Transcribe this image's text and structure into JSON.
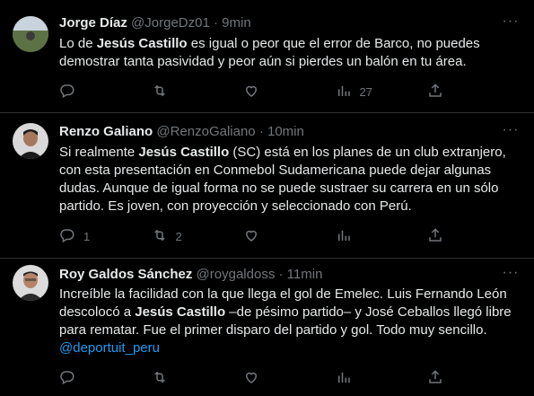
{
  "tweets": [
    {
      "name": "Jorge Díaz",
      "handle": "@JorgeDz01",
      "sep": "·",
      "time": "9min",
      "more": "···",
      "text": [
        {
          "t": "Lo de "
        },
        {
          "t": "Jesús Castillo",
          "b": true
        },
        {
          "t": " es igual o peor que el error de Barco, no puedes demostrar tanta pasividad y peor aún si pierdes un balón en tu área."
        }
      ],
      "counts": {
        "reply": "",
        "retweet": "",
        "like": "",
        "views": "27"
      }
    },
    {
      "name": "Renzo Galiano",
      "handle": "@RenzoGaliano",
      "sep": "·",
      "time": "10min",
      "more": "···",
      "text": [
        {
          "t": "Si realmente "
        },
        {
          "t": "Jesús Castillo",
          "b": true
        },
        {
          "t": " (SC) está en los planes de un club extranjero, con esta presentación en Conmebol Sudamericana puede dejar algunas dudas. Aunque de igual forma no se puede sustraer su carrera en un sólo partido. Es joven, con proyección y seleccionado con Perú."
        }
      ],
      "counts": {
        "reply": "1",
        "retweet": "2",
        "like": "",
        "views": ""
      }
    },
    {
      "name": "Roy Galdos Sánchez",
      "handle": "@roygaldoss",
      "sep": "·",
      "time": "11min",
      "more": "···",
      "text": [
        {
          "t": "Increíble la facilidad con la que llega el gol de Emelec. Luis Fernando León descolocó a "
        },
        {
          "t": "Jesús Castillo",
          "b": true
        },
        {
          "t": " –de pésimo partido– y José Ceballos llegó libre para rematar. Fue el primer disparo del partido y gol. Todo muy sencillo."
        },
        {
          "t": "\n"
        },
        {
          "t": "@deportuit_peru",
          "m": true
        }
      ],
      "counts": {
        "reply": "",
        "retweet": "",
        "like": "",
        "views": ""
      }
    }
  ]
}
